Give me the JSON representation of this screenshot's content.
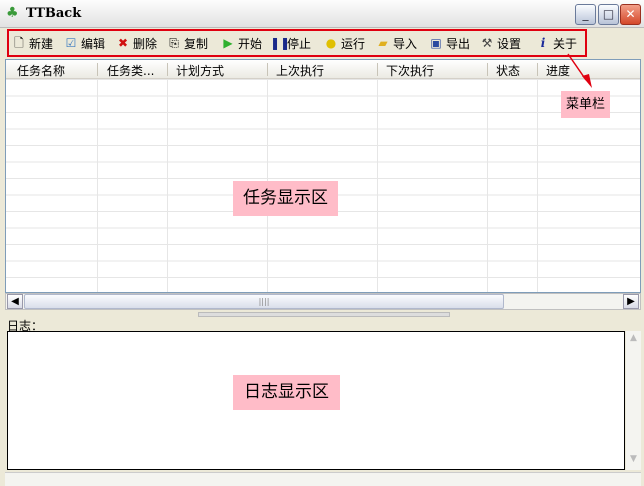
{
  "window": {
    "title": "TTBack"
  },
  "toolbar": [
    {
      "label": "新建",
      "icon": "new-file-icon"
    },
    {
      "label": "编辑",
      "icon": "edit-icon"
    },
    {
      "label": "删除",
      "icon": "delete-icon"
    },
    {
      "label": "复制",
      "icon": "copy-icon"
    },
    {
      "label": "开始",
      "icon": "play-icon"
    },
    {
      "label": "停止",
      "icon": "stop-icon"
    },
    {
      "label": "运行",
      "icon": "bulb-icon"
    },
    {
      "label": "导入",
      "icon": "import-folder-icon"
    },
    {
      "label": "导出",
      "icon": "save-disk-icon"
    },
    {
      "label": "设置",
      "icon": "hammer-icon"
    },
    {
      "label": "关于",
      "icon": "info-icon"
    }
  ],
  "table": {
    "columns": [
      "任务名称",
      "任务类...",
      "计划方式",
      "上次执行",
      "下次执行",
      "状态",
      "进度"
    ]
  },
  "annotations": {
    "menu": "菜单栏",
    "task_area": "任务显示区",
    "log_area": "日志显示区"
  },
  "log": {
    "label": "日志："
  },
  "colors": {
    "annotation_bg": "#ffbcc8",
    "highlight": "#e00010"
  }
}
